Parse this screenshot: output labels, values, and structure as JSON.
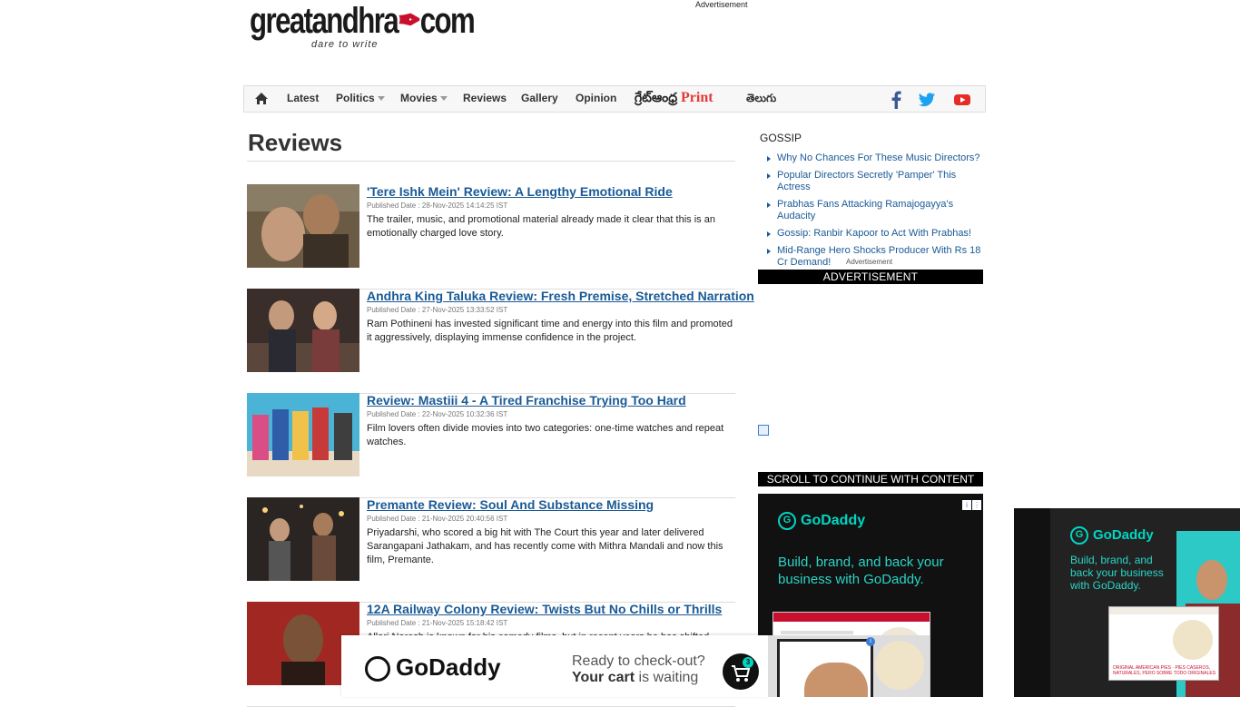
{
  "header": {
    "logo_text": "greatandhra",
    "logo_suffix": "com",
    "logo_tagline": "dare to write",
    "advertisement_label": "Advertisement"
  },
  "nav": {
    "items": [
      {
        "label": "Latest"
      },
      {
        "label": "Politics",
        "dropdown": true
      },
      {
        "label": "Movies",
        "dropdown": true
      },
      {
        "label": "Reviews"
      },
      {
        "label": "Gallery"
      },
      {
        "label": "Opinion"
      }
    ],
    "print_logo_telugu": "గ్రేట్ఆంధ్ర",
    "print_logo_word": "Print",
    "telugu_label": "తెలుగు",
    "social": [
      {
        "icon": "facebook-icon",
        "color": "#3b5998"
      },
      {
        "icon": "twitter-icon",
        "color": "#1da1f2"
      },
      {
        "icon": "youtube-icon",
        "color": "#e52d27"
      }
    ]
  },
  "page": {
    "title": "Reviews"
  },
  "reviews": [
    {
      "title": "'Tere Ishk Mein' Review: A Lengthy Emotional Ride",
      "date": "Published Date : 28-Nov-2025 14:14:25 IST",
      "desc": "The trailer, music, and promotional material already made it clear that this is an emotionally charged love story."
    },
    {
      "title": "Andhra King Taluka Review: Fresh Premise, Stretched Narration",
      "date": "Published Date : 27-Nov-2025 13:33:52 IST",
      "desc": "Ram Pothineni has invested significant time and energy into this film and promoted it aggressively, displaying immense confidence in the project."
    },
    {
      "title": "Review: Mastiii 4 - A Tired Franchise Trying Too Hard",
      "date": "Published Date : 22-Nov-2025 10:32:36 IST",
      "desc": "Film lovers often divide movies into two categories: one-time watches and repeat watches."
    },
    {
      "title": "Premante Review: Soul And Substance Missing",
      "date": "Published Date : 21-Nov-2025 20:40:56 IST",
      "desc": "Priyadarshi, who scored a big hit with The Court this year and later delivered Sarangapani Jathakam, and has recently come with Mithra Mandali and now this film, Premante."
    },
    {
      "title": "12A Railway Colony Review: Twists But No Chills or Thrills",
      "date": "Published Date : 21-Nov-2025 15:18:42 IST",
      "desc": "Allari Naresh is known for his comedy films, but in recent years he has shifted"
    }
  ],
  "sidebar": {
    "gossip_heading": "GOSSIP",
    "gossip_items": [
      "Why No Chances For These Music Directors?",
      "Popular Directors Secretly 'Pamper' This Actress",
      "Prabhas Fans Attacking Ramajogayya's Audacity",
      "Gossip: Ranbir Kapoor to Act With Prabhas!",
      "Mid-Range Hero Shocks Producer With Rs 18 Cr Demand!"
    ],
    "ad_label": "Advertisement",
    "ad_bar": "ADVERTISEMENT",
    "scroll_bar": "SCROLL TO CONTINUE WITH CONTENT"
  },
  "ads": {
    "godaddy_logo": "GoDaddy",
    "side_headline": "Build, brand, and back your business with GoDaddy.",
    "right_headline": "Build, brand, and back your business with GoDaddy.",
    "right_card_text": "ORIGINAL AMERICAN PIES · PIES CASEROS, NATURALES, PERO SOBRE TODO ORIGINALES",
    "bottom_line1": "Ready to check-out?",
    "bottom_line2_bold": "Your cart",
    "bottom_line2_rest": " is waiting",
    "cart_count": "3",
    "brand_color": "#00d6c3"
  }
}
